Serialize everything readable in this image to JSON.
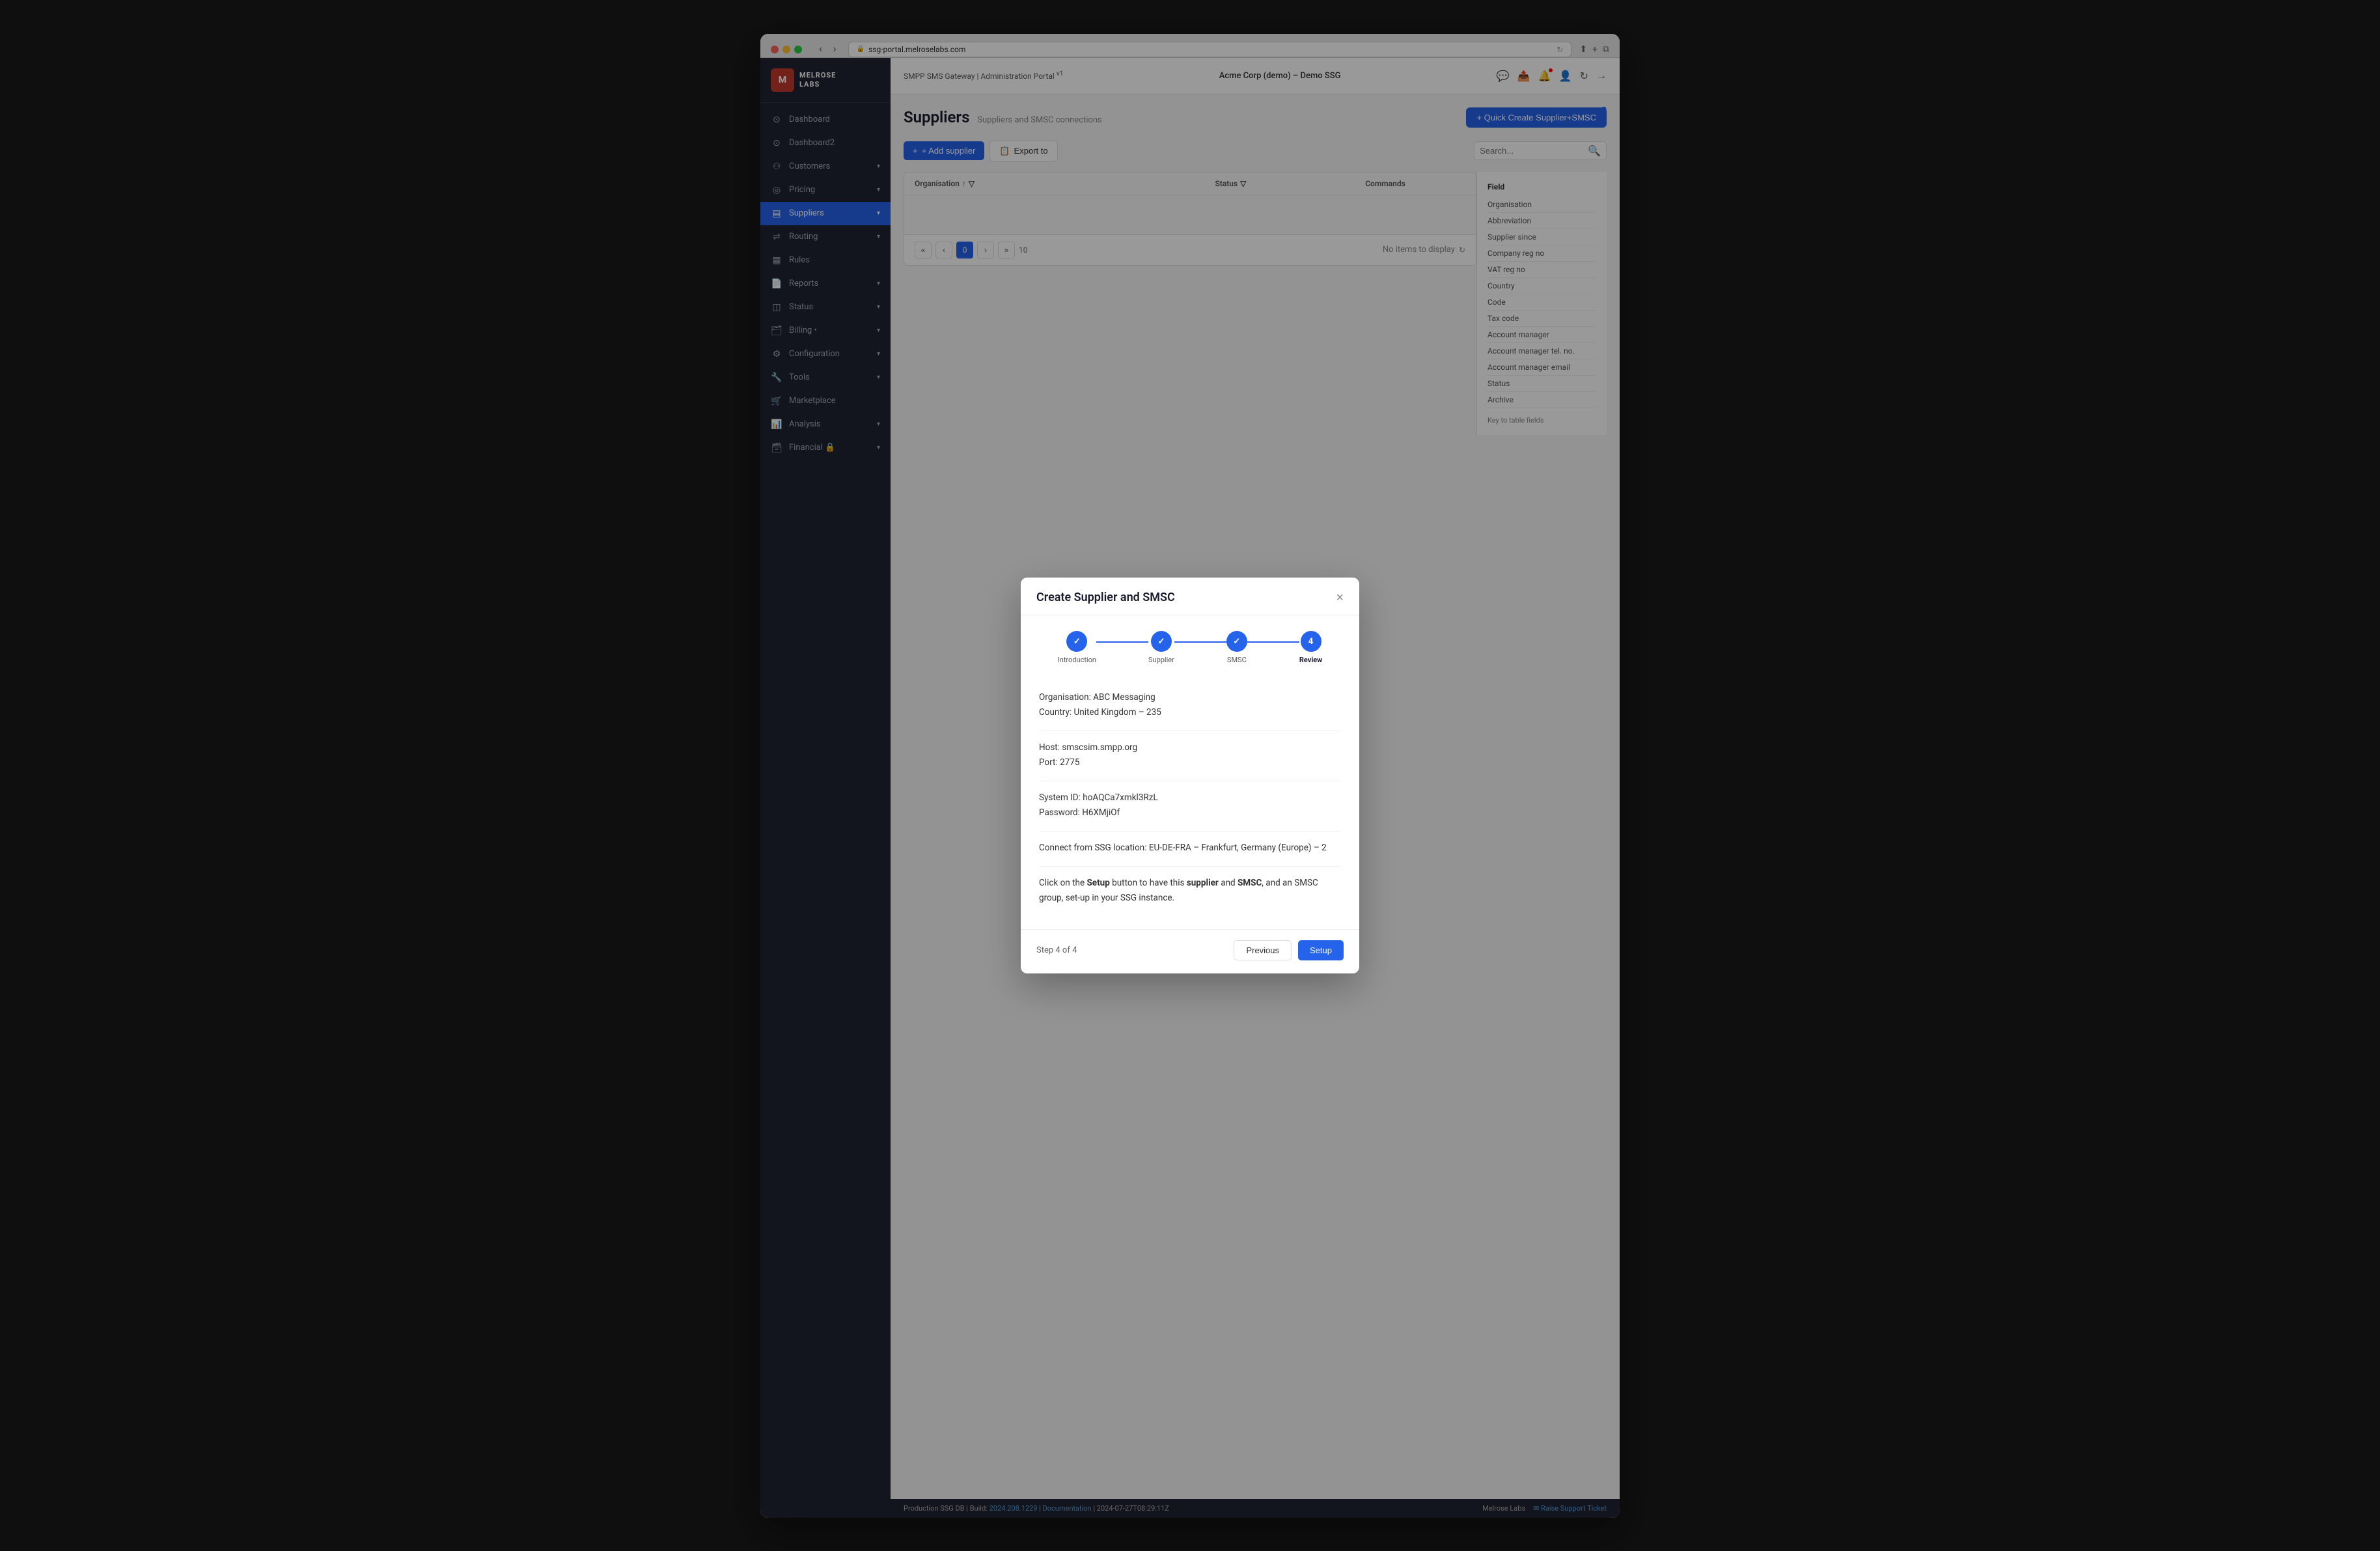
{
  "browser": {
    "url": "ssg-portal.melroselabs.com",
    "reload_icon": "↻"
  },
  "app": {
    "title": "SMPP SMS Gateway | Administration Portal",
    "version": "v1",
    "instance": "Acme Corp (demo) – Demo SSG"
  },
  "sidebar": {
    "logo_text_line1": "MELROSE",
    "logo_text_line2": "LABS",
    "items": [
      {
        "id": "dashboard",
        "label": "Dashboard",
        "icon": "⊙",
        "active": false,
        "has_arrow": false
      },
      {
        "id": "dashboard2",
        "label": "Dashboard2",
        "icon": "⊙",
        "active": false,
        "has_arrow": false
      },
      {
        "id": "customers",
        "label": "Customers",
        "icon": "⚇",
        "active": false,
        "has_arrow": true
      },
      {
        "id": "pricing",
        "label": "Pricing",
        "icon": "◎",
        "active": false,
        "has_arrow": true
      },
      {
        "id": "suppliers",
        "label": "Suppliers",
        "icon": "▤",
        "active": true,
        "has_arrow": true
      },
      {
        "id": "routing",
        "label": "Routing",
        "icon": "⇌",
        "active": false,
        "has_arrow": true
      },
      {
        "id": "rules",
        "label": "Rules",
        "icon": "▦",
        "active": false,
        "has_arrow": false
      },
      {
        "id": "reports",
        "label": "Reports",
        "icon": "📄",
        "active": false,
        "has_arrow": true
      },
      {
        "id": "status",
        "label": "Status",
        "icon": "◫",
        "active": false,
        "has_arrow": true
      },
      {
        "id": "billing",
        "label": "Billing •",
        "icon": "🗂",
        "active": false,
        "has_arrow": true
      },
      {
        "id": "configuration",
        "label": "Configuration",
        "icon": "⚙",
        "active": false,
        "has_arrow": true
      },
      {
        "id": "tools",
        "label": "Tools",
        "icon": "🔧",
        "active": false,
        "has_arrow": true
      },
      {
        "id": "marketplace",
        "label": "Marketplace",
        "icon": "🛒",
        "active": false,
        "has_arrow": false
      },
      {
        "id": "analysis",
        "label": "Analysis",
        "icon": "📊",
        "active": false,
        "has_arrow": true
      },
      {
        "id": "financial",
        "label": "Financial 🔒",
        "icon": "🗃",
        "active": false,
        "has_arrow": true
      }
    ]
  },
  "page": {
    "title": "Suppliers",
    "subtitle": "Suppliers and SMSC connections",
    "help_icon": "?",
    "quick_create_label": "+ Quick Create Supplier+SMSC",
    "add_supplier_label": "+ Add supplier",
    "export_label": "Export to",
    "search_placeholder": "Search...",
    "table_columns": [
      "Organisation",
      "Status",
      "Commands"
    ],
    "pagination": {
      "current_page": "0",
      "page_size": "10",
      "no_items_text": "No items to display"
    },
    "side_panel_title": "Field",
    "side_panel_fields": [
      "Organisation",
      "Abbreviation",
      "Supplier since",
      "Company reg no",
      "VAT reg no",
      "Country",
      "Code",
      "Tax code",
      "Account manager",
      "Account manager tel. no.",
      "Account manager email",
      "Status",
      "Archive"
    ],
    "key_to_fields": "Key to table fields"
  },
  "modal": {
    "title": "Create Supplier and SMSC",
    "steps": [
      {
        "id": "introduction",
        "label": "Introduction",
        "state": "completed",
        "number": "✓"
      },
      {
        "id": "supplier",
        "label": "Supplier",
        "state": "completed",
        "number": "✓"
      },
      {
        "id": "smsc",
        "label": "SMSC",
        "state": "completed",
        "number": "✓"
      },
      {
        "id": "review",
        "label": "Review",
        "state": "active",
        "number": "4"
      }
    ],
    "review": {
      "organisation_line": "Organisation: ABC Messaging",
      "country_line": "Country: United Kingdom – 235",
      "host_line": "Host: smscsim.smpp.org",
      "port_line": "Port: 2775",
      "system_id_line": "System ID: hoAQCa7xmkl3RzL",
      "password_line": "Password: H6XMjiOf",
      "connect_from_label": "Connect from SSG location: EU-DE-FRA – Frankfurt, Germany (Europe) – 2",
      "click_text_prefix": "Click on the ",
      "setup_bold": "Setup",
      "click_text_mid": " button to have this ",
      "supplier_bold": "supplier",
      "click_text_mid2": " and ",
      "smsc_bold": "SMSC",
      "click_text_suffix": ", and an SMSC group, set-up in your SSG instance."
    },
    "step_indicator": "Step 4 of 4",
    "previous_label": "Previous",
    "setup_label": "Setup"
  },
  "footer": {
    "left": "Production SSG DB  |  Build: ",
    "build_number": "2024.208.1229",
    "separator": " | ",
    "documentation_label": "Documentation",
    "timestamp": " | 2024-07-27T08:29:11Z",
    "right_brand": "Melrose Labs",
    "support_label": "✉ Raise Support Ticket"
  }
}
